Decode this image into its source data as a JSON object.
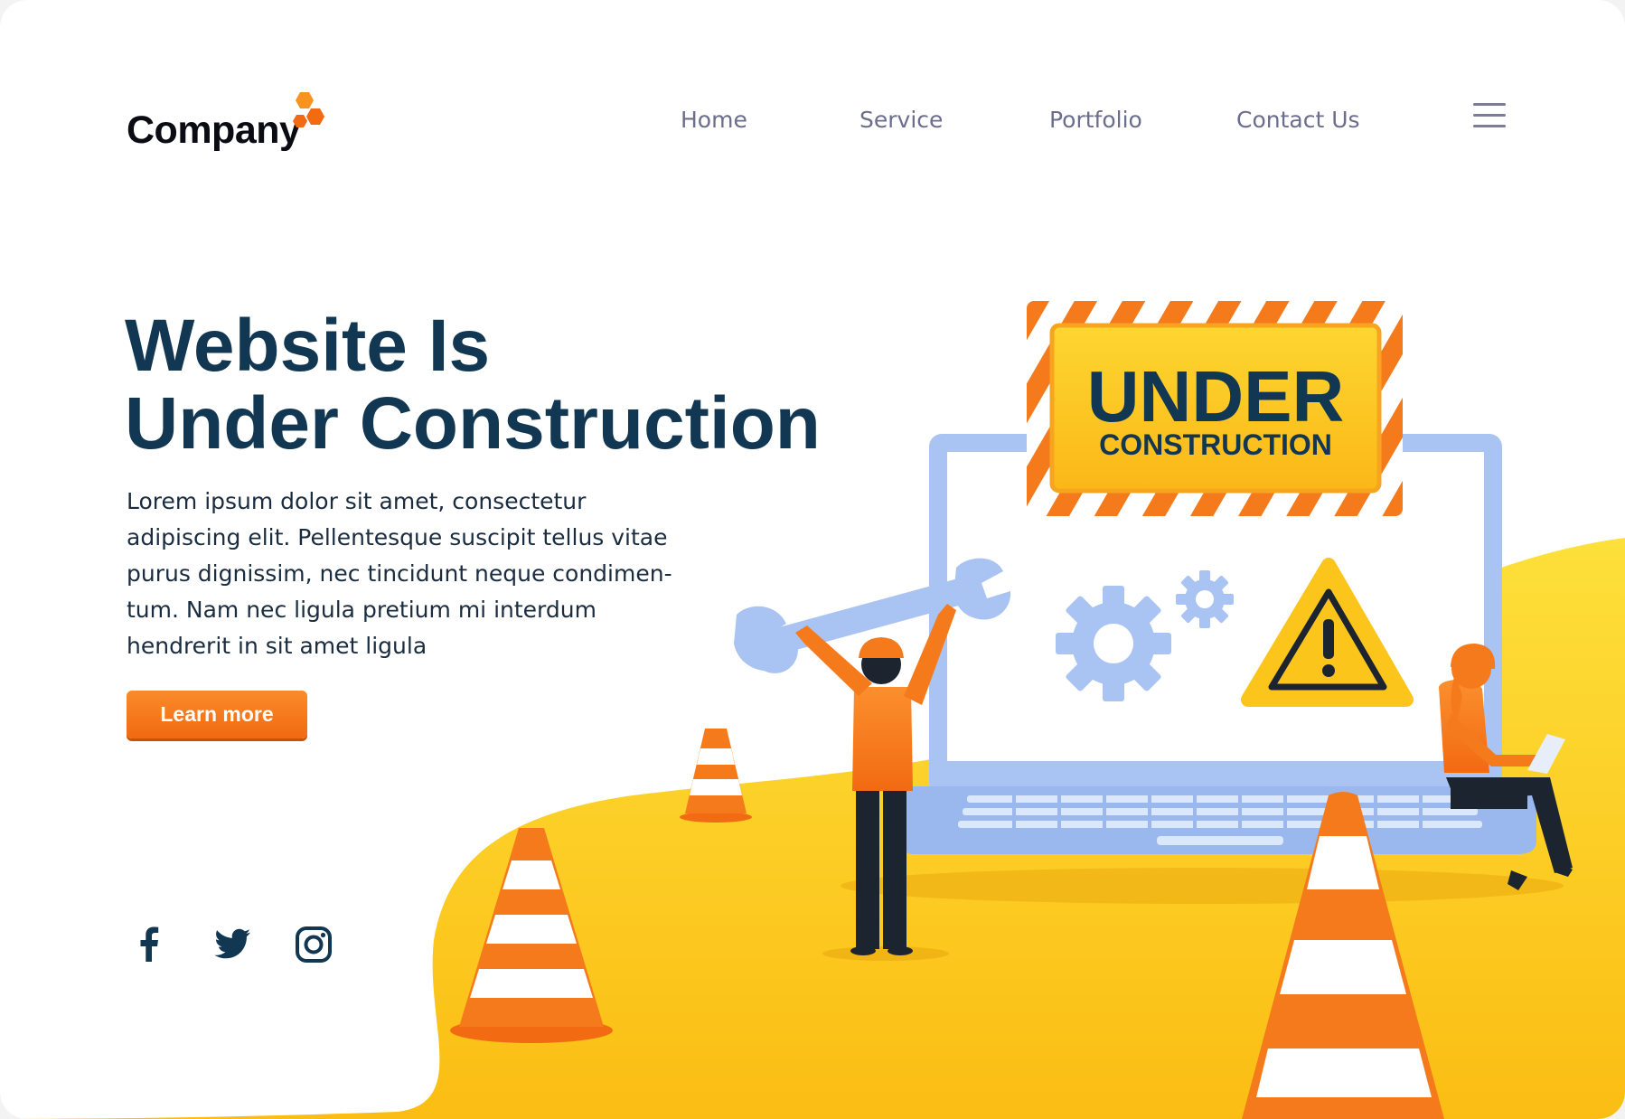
{
  "header": {
    "logo_text": "Company",
    "nav": [
      {
        "label": "Home"
      },
      {
        "label": "Service"
      },
      {
        "label": "Portfolio"
      },
      {
        "label": "Contact Us"
      }
    ],
    "menu_icon": "hamburger-menu-icon"
  },
  "hero": {
    "title_lines": [
      "Website Is",
      "Under Construction"
    ],
    "body_lines": [
      "Lorem ipsum dolor sit amet, consectetur",
      "adipiscing elit. Pellentesque suscipit tellus vitae",
      "purus dignissim, nec tincidunt neque condimen-",
      "tum. Nam nec ligula pretium mi interdum",
      "hendrerit in sit amet ligula"
    ],
    "cta_label": "Learn more"
  },
  "social": [
    "facebook-icon",
    "twitter-icon",
    "instagram-icon"
  ],
  "illustration": {
    "sign_title": "UNDER",
    "sign_subtitle": "CONSTRUCTION",
    "icons": [
      "wrench-icon",
      "gear-icon",
      "warning-icon",
      "traffic-cone-icon"
    ]
  },
  "colors": {
    "primary_dark": "#123752",
    "accent_orange": "#f57a1c",
    "accent_yellow": "#fcd21e",
    "nav_text": "#6b6d8c",
    "screen_blue": "#a9c4f2"
  }
}
